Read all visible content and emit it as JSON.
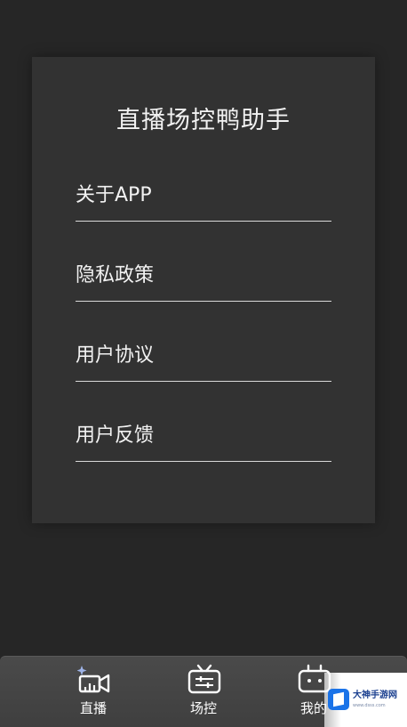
{
  "app": {
    "title": "直播场控鸭助手"
  },
  "menu": {
    "items": [
      {
        "label": "关于APP",
        "icon": "none"
      },
      {
        "label": "隐私政策",
        "icon": "none"
      },
      {
        "label": "用户协议",
        "icon": "none"
      },
      {
        "label": "用户反馈",
        "icon": "none"
      }
    ]
  },
  "tabbar": {
    "tabs": [
      {
        "label": "直播",
        "icon": "live-camera-icon"
      },
      {
        "label": "场控",
        "icon": "tv-control-icon"
      },
      {
        "label": "我的",
        "icon": "robot-face-icon"
      }
    ]
  },
  "watermark": {
    "title": "大神手游网",
    "url": "www.dsss.com"
  },
  "colors": {
    "background": "#262626",
    "card": "#323232",
    "tabbar": "#454545",
    "text": "#f2f2f2",
    "accent_logo": "#1a73e8"
  }
}
